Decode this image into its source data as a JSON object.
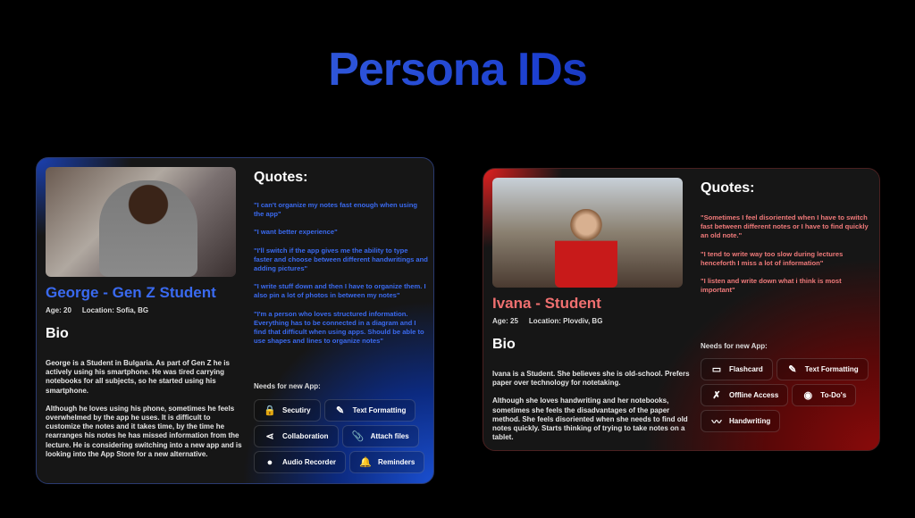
{
  "title": "Persona IDs",
  "accent_blue": "#3a6af0",
  "accent_red": "#f07070",
  "personas": [
    {
      "name": "George - Gen Z Student",
      "age": "Age: 20",
      "location": "Location: Sofia, BG",
      "bio_heading": "Bio",
      "bio": [
        "George is a Student in Bulgaria. As part of Gen Z he is actively using his smartphone. He was tired carrying notebooks for all subjects, so he started using his smartphone.",
        "Although he loves using his phone, sometimes he feels overwhelmed by the app he uses. It is difficult to customize the notes and it takes time, by the time he rearranges his notes he has missed information from the lecture. He is considering switching into a new app and is looking into the App Store for a new alternative."
      ],
      "quotes_heading": "Quotes:",
      "quotes": [
        "\"I can't organize my notes fast enough when using the app\"",
        "\"I want better experience\"",
        "\"I'll switch if the app gives me the ability to type faster and choose between different handwritings and adding pictures\"",
        "\"I write stuff down and then I have to organize them. I also pin a lot of photos in between my notes\"",
        "\"I'm a person who loves structured information.  Everything has to be connected in a diagram and I find that difficult when using apps. Should be able to use shapes and lines to organize notes\""
      ],
      "needs_heading": "Needs for new App:",
      "needs": [
        {
          "label": "Secutiry",
          "icon": "lock-icon",
          "glyph": "🔒"
        },
        {
          "label": "Text Formatting",
          "icon": "edit-icon",
          "glyph": "✎"
        },
        {
          "label": "Collaboration",
          "icon": "share-icon",
          "glyph": "⋖"
        },
        {
          "label": "Attach files",
          "icon": "paperclip-icon",
          "glyph": "📎"
        },
        {
          "label": "Audio Recorder",
          "icon": "record-icon",
          "glyph": "●"
        },
        {
          "label": "Reminders",
          "icon": "bell-icon",
          "glyph": "🔔"
        }
      ]
    },
    {
      "name": "Ivana - Student",
      "age": "Age: 25",
      "location": "Location: Plovdiv, BG",
      "bio_heading": "Bio",
      "bio": [
        "Ivana is a Student. She believes she is old-school. Prefers paper over technology for notetaking.",
        "Although she loves handwriting and her notebooks, sometimes she feels the disadvantages of the paper method. She feels disoriented when she needs to find old notes quickly. Starts thinking of trying to take notes on a tablet."
      ],
      "quotes_heading": "Quotes:",
      "quotes": [
        "\"Sometimes I feel disoriented when I have to switch fast between different notes or I have to find quickly an old note.\"",
        "\"I tend to write way too slow during lectures henceforth I miss a lot of information\"",
        "\"I listen and write down what i think is most important\""
      ],
      "needs_heading": "Needs for new App:",
      "needs": [
        {
          "label": "Flashcard",
          "icon": "cards-icon",
          "glyph": "▭"
        },
        {
          "label": "Text Formatting",
          "icon": "edit-icon",
          "glyph": "✎"
        },
        {
          "label": "Offline Access",
          "icon": "wifi-off-icon",
          "glyph": "✗"
        },
        {
          "label": "To-Do's",
          "icon": "radio-icon",
          "glyph": "◉"
        },
        {
          "label": "Handwriting",
          "icon": "pen-scribble-icon",
          "glyph": "〰"
        }
      ]
    }
  ]
}
